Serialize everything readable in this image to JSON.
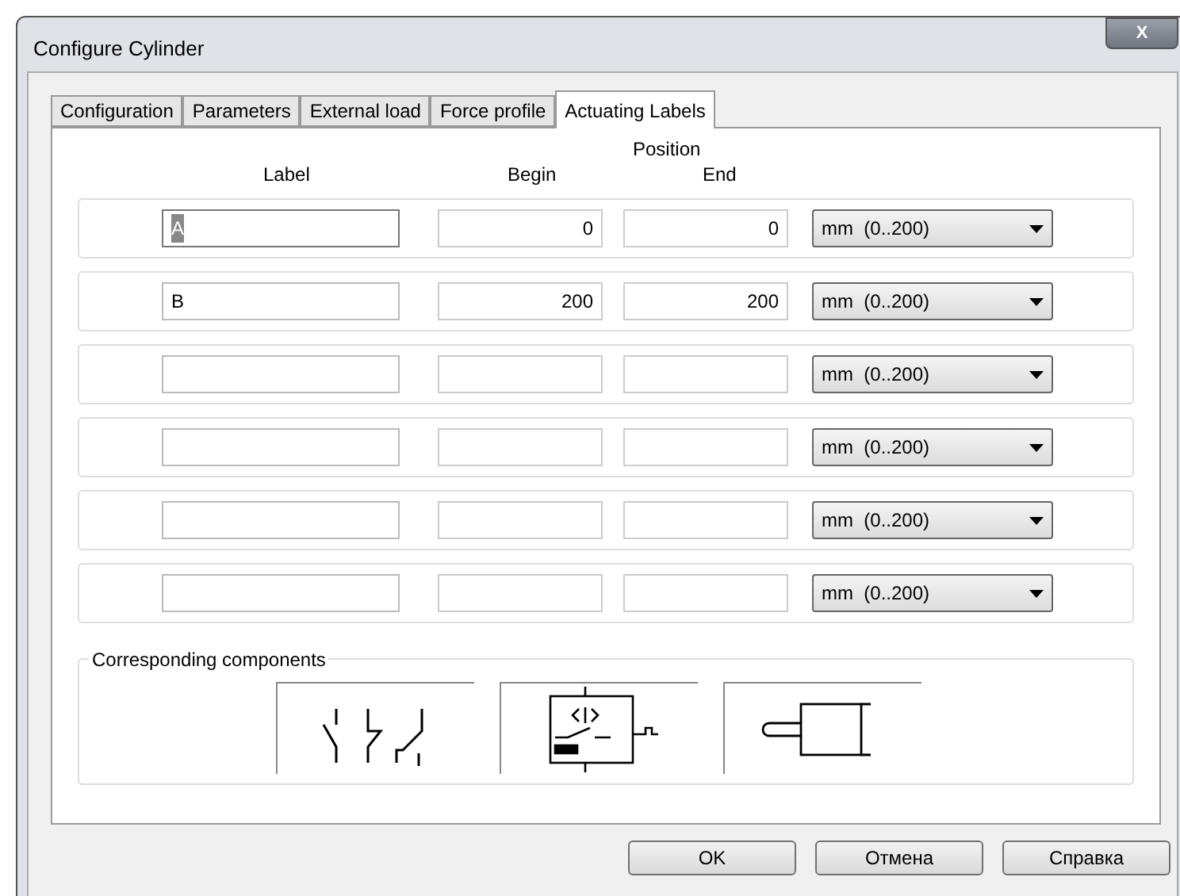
{
  "window": {
    "title": "Configure Cylinder",
    "close": "X"
  },
  "tabs": [
    {
      "label": "Configuration",
      "selected": false
    },
    {
      "label": "Parameters",
      "selected": false
    },
    {
      "label": "External load",
      "selected": false
    },
    {
      "label": "Force profile",
      "selected": false
    },
    {
      "label": "Actuating Labels",
      "selected": true
    }
  ],
  "headers": {
    "position": "Position",
    "label": "Label",
    "begin": "Begin",
    "end": "End"
  },
  "rows": [
    {
      "label": "A",
      "label_selected": true,
      "begin": "0",
      "end": "0",
      "unit": "mm  (0..200)"
    },
    {
      "label": "B",
      "label_selected": false,
      "begin": "200",
      "end": "200",
      "unit": "mm  (0..200)"
    },
    {
      "unit": "mm  (0..200)"
    },
    {
      "unit": "mm  (0..200)"
    },
    {
      "unit": "mm  (0..200)"
    },
    {
      "unit": "mm  (0..200)"
    }
  ],
  "components": {
    "title": "Corresponding components",
    "items": [
      {
        "kind": "switches"
      },
      {
        "kind": "sensor"
      },
      {
        "kind": "cylinder"
      }
    ]
  },
  "buttons": [
    "OK",
    "Отмена",
    "Справка"
  ]
}
